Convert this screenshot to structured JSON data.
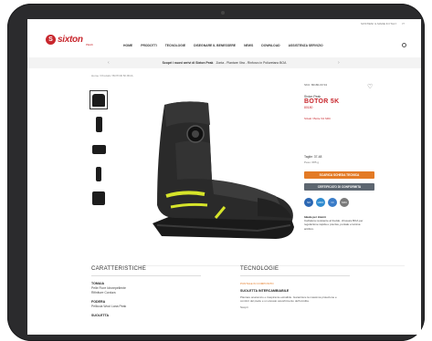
{
  "topbar": {
    "items": [
      "SOSTIENI IL MADE IN ITALY",
      "IT"
    ]
  },
  "brand": {
    "logo_letter": "S",
    "logo_text": "sixton",
    "sub": "PEAK"
  },
  "nav": {
    "items": [
      "HOME",
      "PRODOTTI",
      "TECNOLOGIE",
      "DISEGNARE IL BENESSERE",
      "NEWS",
      "DOWNLOAD",
      "ASSISTENZA SERVIZIO"
    ]
  },
  "promo": {
    "bold": "Scopri i nuovi arrivi di Sixton Peak",
    "text": "Zonta - Plantare Xtra - Rinforzo in Poliuretano BOA"
  },
  "breadcrumb": "Home / Prodotti / BOTOR 5K BOA",
  "product": {
    "sku": "SKU: 80180-00 S3",
    "brandline": "Sixton Peak",
    "name": "BOTOR 5K",
    "code": "80180",
    "category": "Stivali / Botte S3 SRC",
    "sizes": "Taglie: 37-48",
    "weight": "Peso: 685 g",
    "btn_primary": "SCARICA SCHEDA TECNICA",
    "btn_secondary": "CERTIFICATO DI CONFORMITA",
    "certs": [
      {
        "label": "S3",
        "color": "#2b67b3"
      },
      {
        "label": "HRO",
        "color": "#2f8bd0"
      },
      {
        "label": "CI",
        "color": "#3a7cc8"
      },
      {
        "label": "SRC",
        "color": "#7a7a7a"
      }
    ],
    "desc_title": "Ideale per interni",
    "desc": "Calzatura resistente al freddo, chiusura BOA per regolazione rapida e precisa, puntale e lamina antiforo."
  },
  "caratteristiche": {
    "title": "CARATTERISTICHE",
    "specs": [
      {
        "key": "TOMAIA",
        "val": "Pelle Fiore Idrorepellente"
      },
      {
        "key": "",
        "val": "Rifiniture Cordura"
      },
      {
        "key": "FODERA",
        "val": "Pelliccia Wool Lana Peak"
      },
      {
        "key": "SUOLETTA",
        "val": ""
      }
    ]
  },
  "tecnologie": {
    "title": "TECNOLOGIE",
    "caption": "PUNTALE IN COMPOSITO",
    "item_title": "SUOLETTA INTERCAMBIABILE",
    "item_text": "Plantare anatomico e traspirante estraibile. Garantisce la massima protezione e comfort del piede e un elevato assorbimento dell'umidita.",
    "more": "Scopri"
  },
  "colors": {
    "accent": "#c8272d",
    "orange": "#e37a25",
    "slate": "#5d6670",
    "hi_vis": "#d6e42a"
  }
}
